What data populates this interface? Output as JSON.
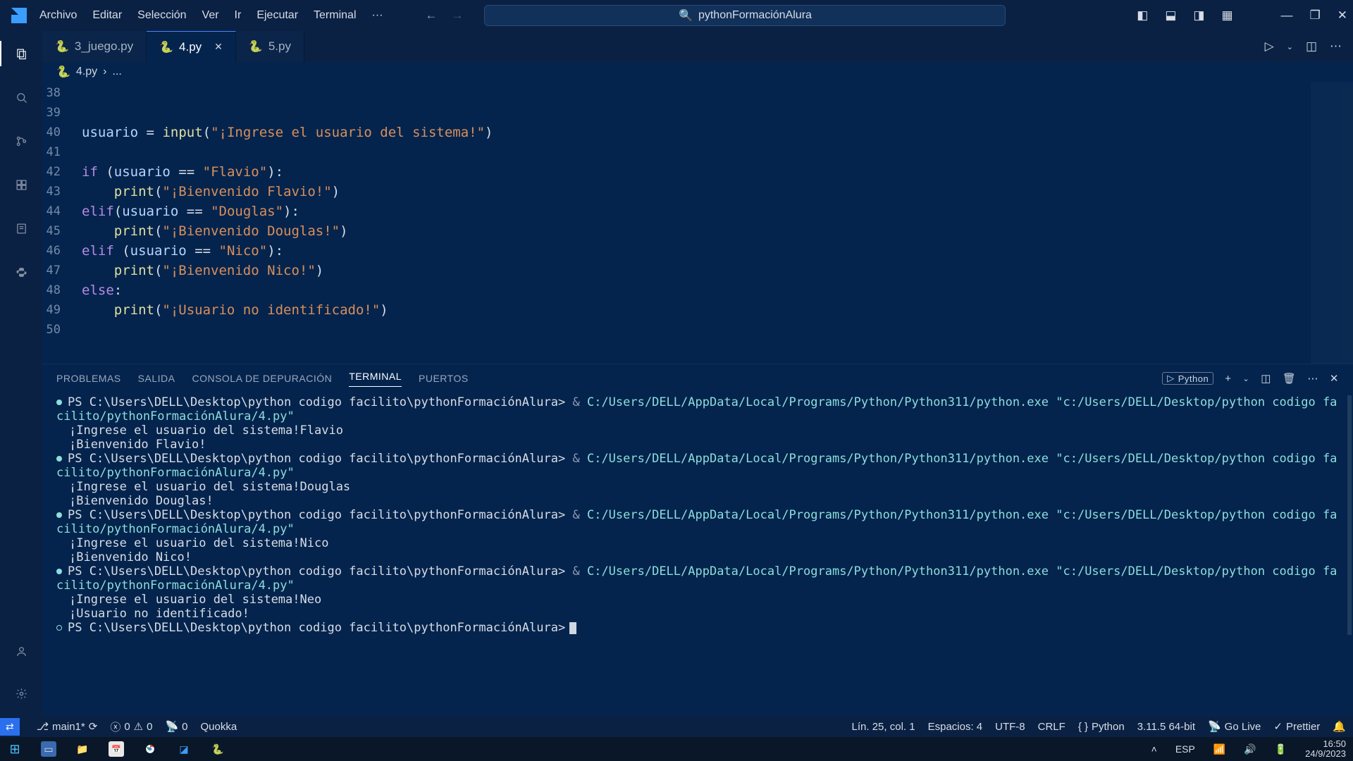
{
  "menu": [
    "Archivo",
    "Editar",
    "Selección",
    "Ver",
    "Ir",
    "Ejecutar",
    "Terminal",
    "···"
  ],
  "searchbox": "pythonFormaciónAlura",
  "tabs": [
    {
      "label": "3_juego.py",
      "active": false,
      "close": false
    },
    {
      "label": "4.py",
      "active": true,
      "close": true
    },
    {
      "label": "5.py",
      "active": false,
      "close": false
    }
  ],
  "breadcrumb": {
    "file": "4.py",
    "rest": "..."
  },
  "code": {
    "start": 38,
    "lines": [
      "",
      "",
      {
        "type": "assign",
        "var": "usuario",
        "fn": "input",
        "str": "\"¡Ingrese el usuario del sistema!\""
      },
      "",
      {
        "type": "if",
        "cond_var": "usuario",
        "cond_str": "\"Flavio\""
      },
      {
        "type": "print",
        "str": "\"¡Bienvenido Flavio!\""
      },
      {
        "type": "elif_nospace",
        "cond_var": "usuario",
        "cond_str": "\"Douglas\""
      },
      {
        "type": "print",
        "str": "\"¡Bienvenido Douglas!\""
      },
      {
        "type": "elif",
        "cond_var": "usuario",
        "cond_str": "\"Nico\""
      },
      {
        "type": "print",
        "str": "\"¡Bienvenido Nico!\""
      },
      {
        "type": "else"
      },
      {
        "type": "print",
        "str": "\"¡Usuario no identificado!\""
      },
      ""
    ]
  },
  "panel_tabs": [
    "PROBLEMAS",
    "SALIDA",
    "CONSOLA DE DEPURACIÓN",
    "TERMINAL",
    "PUERTOS"
  ],
  "panel_active": 3,
  "terminal_badge": "Python",
  "terminal": {
    "prompt": "PS C:\\Users\\DELL\\Desktop\\python codigo facilito\\pythonFormaciónAlura>",
    "exe": "C:/Users/DELL/AppData/Local/Programs/Python/Python311/python.exe",
    "arg": "\"c:/Users/DELL/Desktop/python codigo facilito/pythonFormaciónAlura/4.py\"",
    "runs": [
      {
        "input": "Flavio",
        "out": "¡Bienvenido Flavio!"
      },
      {
        "input": "Douglas",
        "out": "¡Bienvenido Douglas!"
      },
      {
        "input": "Nico",
        "out": "¡Bienvenido Nico!"
      },
      {
        "input": "Neo",
        "out": "¡Usuario no identificado!"
      }
    ],
    "input_prompt": "¡Ingrese el usuario del sistema!"
  },
  "status": {
    "branch": "main1*",
    "sync": "0",
    "errors": "0",
    "warnings": "0",
    "port": "0",
    "quokka": "Quokka",
    "pos": "Lín. 25, col. 1",
    "spaces": "Espacios: 4",
    "encoding": "UTF-8",
    "eol": "CRLF",
    "lang": "Python",
    "ver": "3.11.5 64-bit",
    "golive": "Go Live",
    "prettier": "Prettier"
  },
  "system": {
    "lang": "ESP",
    "time": "16:50",
    "date": "24/9/2023"
  }
}
